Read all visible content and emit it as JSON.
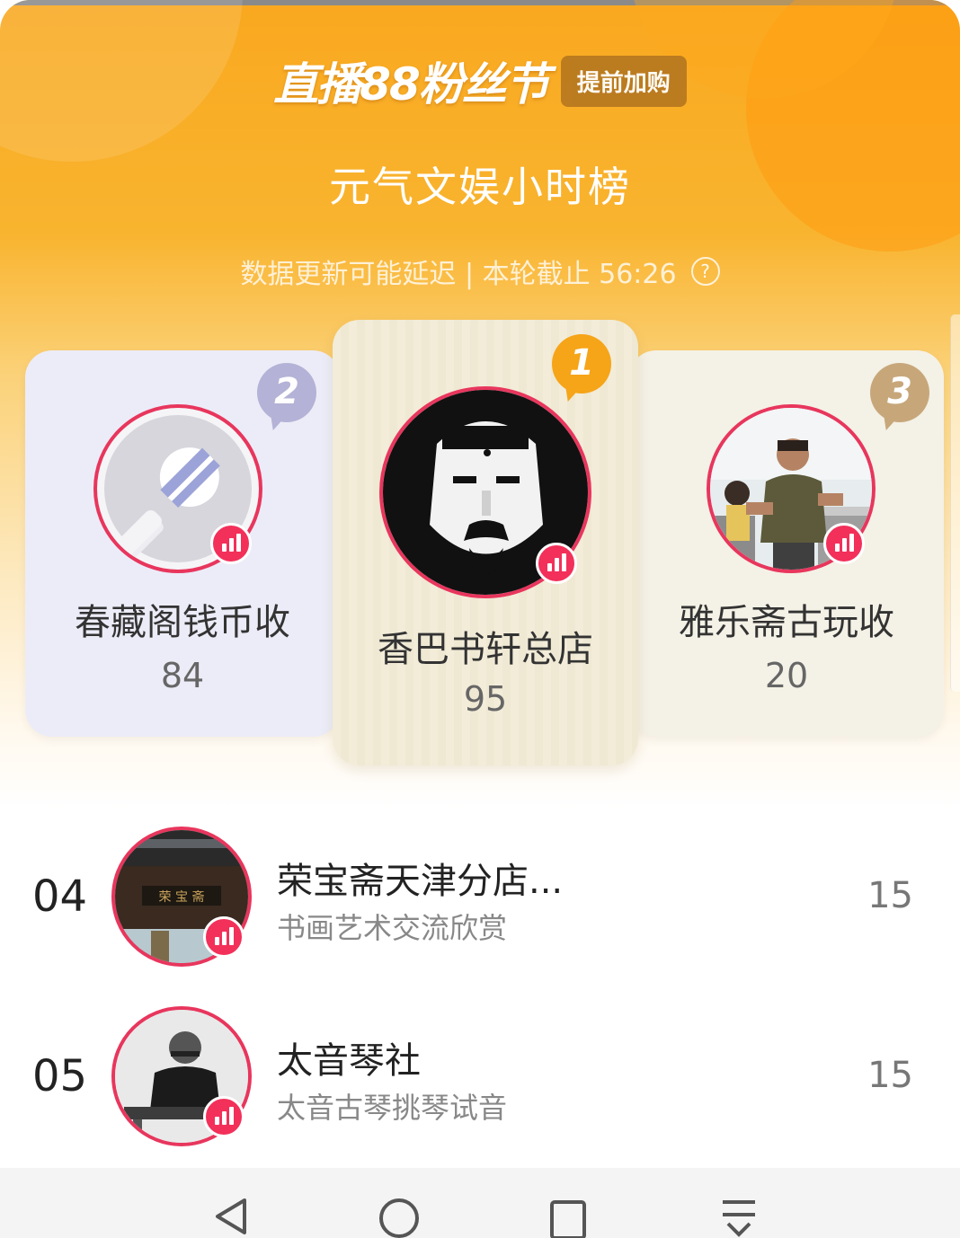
{
  "header": {
    "brand_title": "直播88粉丝节",
    "early_badge": "提前加购",
    "board_title": "元气文娱小时榜",
    "subline": "数据更新可能延迟 | 本轮截止 56:26",
    "help_icon": "question-circle-icon"
  },
  "podium": [
    {
      "rank": "1",
      "name": "香巴书轩总店",
      "score": "95",
      "badge_color": "#f6a418"
    },
    {
      "rank": "2",
      "name": "春藏阁钱币收",
      "score": "84",
      "badge_color": "#b4b2d6"
    },
    {
      "rank": "3",
      "name": "雅乐斋古玩收",
      "score": "20",
      "badge_color": "#c7a77a"
    }
  ],
  "list": [
    {
      "rank": "04",
      "name": "荣宝斋天津分店...",
      "desc": "书画艺术交流欣赏",
      "score": "15"
    },
    {
      "rank": "05",
      "name": "太音琴社",
      "desc": "太音古琴挑琴试音",
      "score": "15"
    }
  ],
  "live_icon": "live-bars-icon",
  "nav": {
    "back": "back-triangle-icon",
    "home": "home-circle-icon",
    "recents": "recents-square-icon",
    "menu": "download-menu-icon"
  },
  "colors": {
    "accent_orange": "#f9a81f",
    "live_red": "#f2305a",
    "avatar_ring": "#e8365d"
  }
}
